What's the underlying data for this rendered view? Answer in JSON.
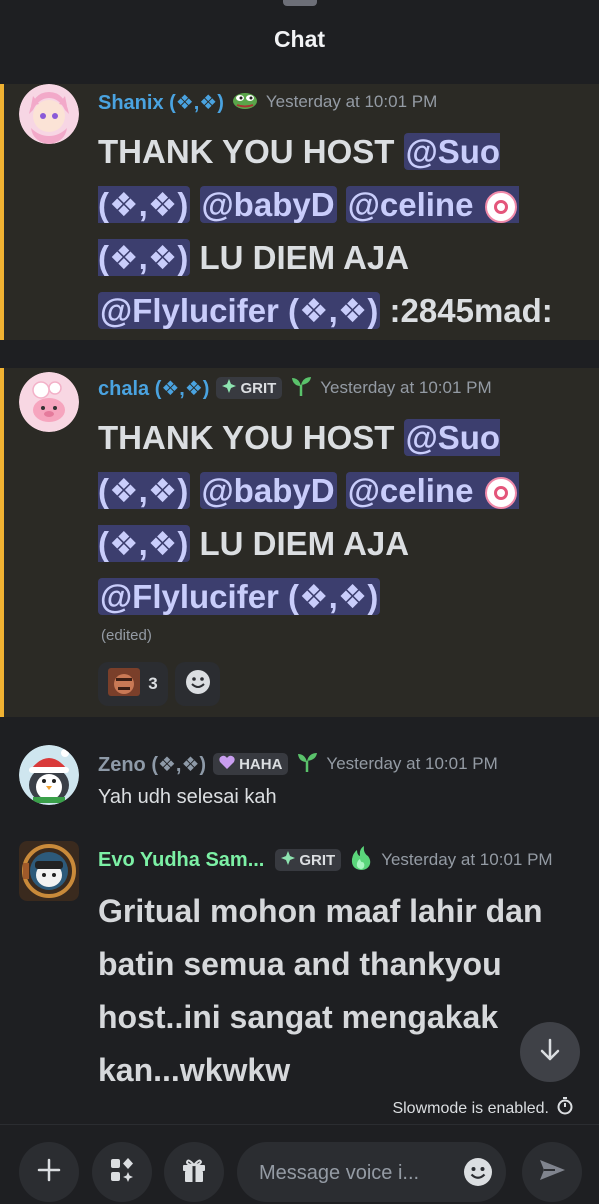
{
  "header": {
    "title": "Chat"
  },
  "messages": [
    {
      "username": "Shanix (❖,❖)",
      "timestamp": "Yesterday at 10:01 PM",
      "text": [
        "THANK YOU HOST ",
        "@Suo (❖,❖)",
        " ",
        "@babyD",
        " ",
        "@celine",
        " ",
        "(❖,❖)",
        " LU DIEM AJA ",
        "@Flylucifer (❖,❖)",
        " :2845mad:"
      ]
    },
    {
      "username": "chala (❖,❖)",
      "tag": "GRIT",
      "timestamp": "Yesterday at 10:01 PM",
      "text": [
        "THANK YOU HOST ",
        "@Suo (❖,❖)",
        " ",
        "@babyD",
        " ",
        "@celine",
        " ",
        "(❖,❖)",
        " LU DIEM AJA ",
        "@Flylucifer (❖,❖)"
      ],
      "edited_label": "(edited)",
      "reaction_count": "3"
    },
    {
      "username": "Zeno (❖,❖)",
      "tag": "HAHA",
      "timestamp": "Yesterday at 10:01 PM",
      "text": "Yah udh selesai kah"
    },
    {
      "username": "Evo Yudha Sam...",
      "tag": "GRIT",
      "timestamp": "Yesterday at 10:01 PM",
      "text": "Gritual mohon maaf lahir dan batin semua and thankyou host..ini sangat mengakak kan...wkwkw"
    }
  ],
  "status": {
    "slowmode": "Slowmode is enabled."
  },
  "composer": {
    "placeholder": "Message voice i..."
  },
  "colors": {
    "background": "#1e1f22",
    "highlight_bg": "#2b2a25",
    "highlight_bar": "#f0b232",
    "mention_bg": "#3c3e6e",
    "mention_text": "#c9cdfb",
    "username_blue": "#4aa3e0",
    "username_gray": "#8e9aa8",
    "username_green": "#7cf0a5"
  },
  "icons": [
    "plus-icon",
    "apps-icon",
    "gift-icon",
    "emoji-icon",
    "send-icon",
    "arrow-down-icon",
    "timer-icon",
    "diamond-tag-icon",
    "heart-tag-icon",
    "sprout-icon",
    "flame-icon",
    "pepe-icon"
  ]
}
